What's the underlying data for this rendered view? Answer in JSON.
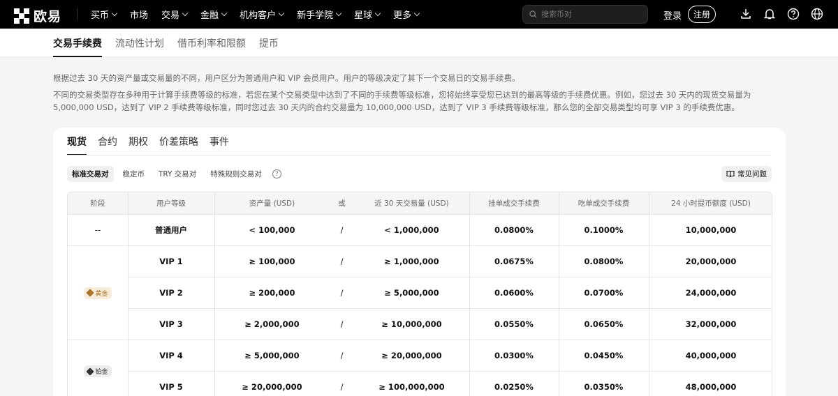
{
  "nav": {
    "logo_text": "欧易",
    "items": [
      {
        "label": "买币",
        "chevron": true
      },
      {
        "label": "市场",
        "chevron": false
      },
      {
        "label": "交易",
        "chevron": true
      },
      {
        "label": "金融",
        "chevron": true
      },
      {
        "label": "机构客户",
        "chevron": true
      },
      {
        "label": "新手学院",
        "chevron": true
      },
      {
        "label": "星球",
        "chevron": true
      },
      {
        "label": "更多",
        "chevron": true
      }
    ],
    "search_placeholder": "搜索币对",
    "login": "登录",
    "register": "注册"
  },
  "subnav": {
    "tabs": [
      "交易手续费",
      "流动性计划",
      "借币利率和限额",
      "提币"
    ]
  },
  "description": {
    "line1": "根据过去 30 天的资产量或交易量的不同，用户区分为普通用户和 VIP 会员用户。用户的等级决定了其下一个交易日的交易手续费。",
    "line2": "不同的交易类型存在多种用于计算手续费等级的标准，若您在某个交易类型中达到了不同的手续费等级标准，您将始终享受您已达到的最高等级的手续费优惠。例如，您过去 30 天内的现货交易量为",
    "line3": "5,000,000 USD，达到了 VIP 2 手续费等级标准，同时您过去 30 天内的合约交易量为 10,000,000 USD，达到了 VIP 3 手续费等级标准，那么您的全部交易类型均可享 VIP 3 的手续费优惠。"
  },
  "market_tabs": [
    "现货",
    "合约",
    "期权",
    "价差策略",
    "事件"
  ],
  "filters": [
    "标准交易对",
    "稳定币",
    "TRY 交易对",
    "特殊规则交易对"
  ],
  "faq_label": "常见问题",
  "table": {
    "headers": [
      "阶段",
      "用户等级",
      "资产量 (USD)",
      "或",
      "近 30 天交易量 (USD)",
      "挂单成交手续费",
      "吃单成交手续费",
      "24 小时提币额度 (USD)"
    ],
    "rows": [
      {
        "level": "普通用户",
        "assets": "< 100,000",
        "or": "/",
        "volume": "< 1,000,000",
        "maker": "0.0800%",
        "taker": "0.1000%",
        "withdraw": "10,000,000"
      },
      {
        "level": "VIP 1",
        "assets": "≥ 100,000",
        "or": "/",
        "volume": "≥ 1,000,000",
        "maker": "0.0675%",
        "taker": "0.0800%",
        "withdraw": "20,000,000"
      },
      {
        "level": "VIP 2",
        "assets": "≥ 200,000",
        "or": "/",
        "volume": "≥ 5,000,000",
        "maker": "0.0600%",
        "taker": "0.0700%",
        "withdraw": "24,000,000"
      },
      {
        "level": "VIP 3",
        "assets": "≥ 2,000,000",
        "or": "/",
        "volume": "≥ 10,000,000",
        "maker": "0.0550%",
        "taker": "0.0650%",
        "withdraw": "32,000,000"
      },
      {
        "level": "VIP 4",
        "assets": "≥ 5,000,000",
        "or": "/",
        "volume": "≥ 20,000,000",
        "maker": "0.0300%",
        "taker": "0.0450%",
        "withdraw": "40,000,000"
      },
      {
        "level": "VIP 5",
        "assets": "≥ 20,000,000",
        "or": "/",
        "volume": "≥ 100,000,000",
        "maker": "0.0250%",
        "taker": "0.0350%",
        "withdraw": "48,000,000"
      }
    ],
    "stages": [
      {
        "label": "--",
        "type": "text",
        "rows": 1
      },
      {
        "label": "黄金",
        "type": "badge",
        "rows": 3,
        "color": "#a9742b",
        "bg": "#f6ecd9"
      },
      {
        "label": "铂金",
        "type": "badge",
        "rows": 2,
        "color": "#333333",
        "bg": "#ececec"
      }
    ]
  }
}
